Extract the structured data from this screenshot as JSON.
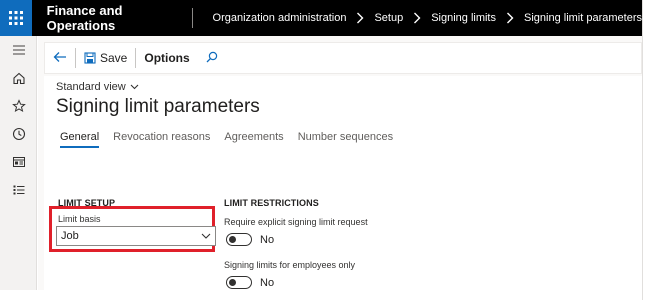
{
  "header": {
    "app_title": "Finance and Operations",
    "breadcrumb": [
      "Organization administration",
      "Setup",
      "Signing limits",
      "Signing limit parameters"
    ]
  },
  "nav": {
    "icons": [
      "hamburger-icon",
      "home-icon",
      "star-icon",
      "clock-icon",
      "workspace-icon",
      "list-icon"
    ]
  },
  "actionpane": {
    "save_label": "Save",
    "options_label": "Options"
  },
  "page": {
    "view_name": "Standard view",
    "title": "Signing limit parameters",
    "tabs": [
      {
        "label": "General",
        "active": true
      },
      {
        "label": "Revocation reasons",
        "active": false
      },
      {
        "label": "Agreements",
        "active": false
      },
      {
        "label": "Number sequences",
        "active": false
      }
    ]
  },
  "limit_setup": {
    "title": "LIMIT SETUP",
    "limit_basis_label": "Limit basis",
    "limit_basis_value": "Job"
  },
  "limit_restrictions": {
    "title": "LIMIT RESTRICTIONS",
    "explicit_label": "Require explicit signing limit request",
    "explicit_value": "No",
    "employees_label": "Signing limits for employees only",
    "employees_value": "No"
  },
  "colors": {
    "accent": "#0f6cbd",
    "highlight": "#e0202a",
    "topbar": "#000000"
  }
}
